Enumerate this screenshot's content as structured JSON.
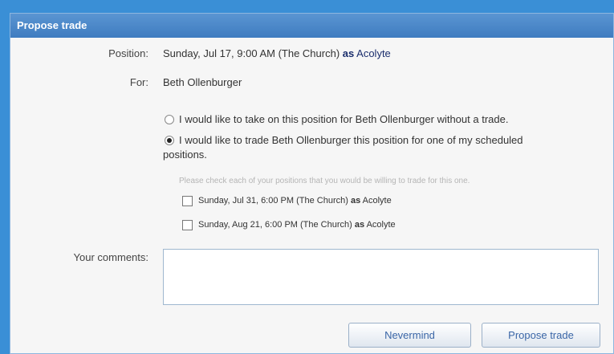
{
  "dialog": {
    "title": "Propose trade",
    "position_label": "Position:",
    "position_value": "Sunday, Jul 17, 9:00 AM (The Church)",
    "position_as": "as",
    "position_role": "Acolyte",
    "for_label": "For:",
    "for_value": "Beth Ollenburger",
    "options": {
      "no_trade": "I would like to take on this position for Beth Ollenburger without a trade.",
      "trade_line1": "I would like to trade Beth Ollenburger this position for one of my scheduled",
      "trade_line2": "positions.",
      "selected": "trade"
    },
    "hint": "Please check each of your positions that you would be willing to trade for this one.",
    "positions": [
      {
        "text": "Sunday, Jul 31, 6:00 PM (The Church)",
        "as": "as",
        "role": "Acolyte",
        "checked": false
      },
      {
        "text": "Sunday, Aug 21, 6:00 PM (The Church)",
        "as": "as",
        "role": "Acolyte",
        "checked": false
      }
    ],
    "comments_label": "Your comments:",
    "comments_value": "",
    "nevermind_label": "Nevermind",
    "propose_label": "Propose trade"
  }
}
